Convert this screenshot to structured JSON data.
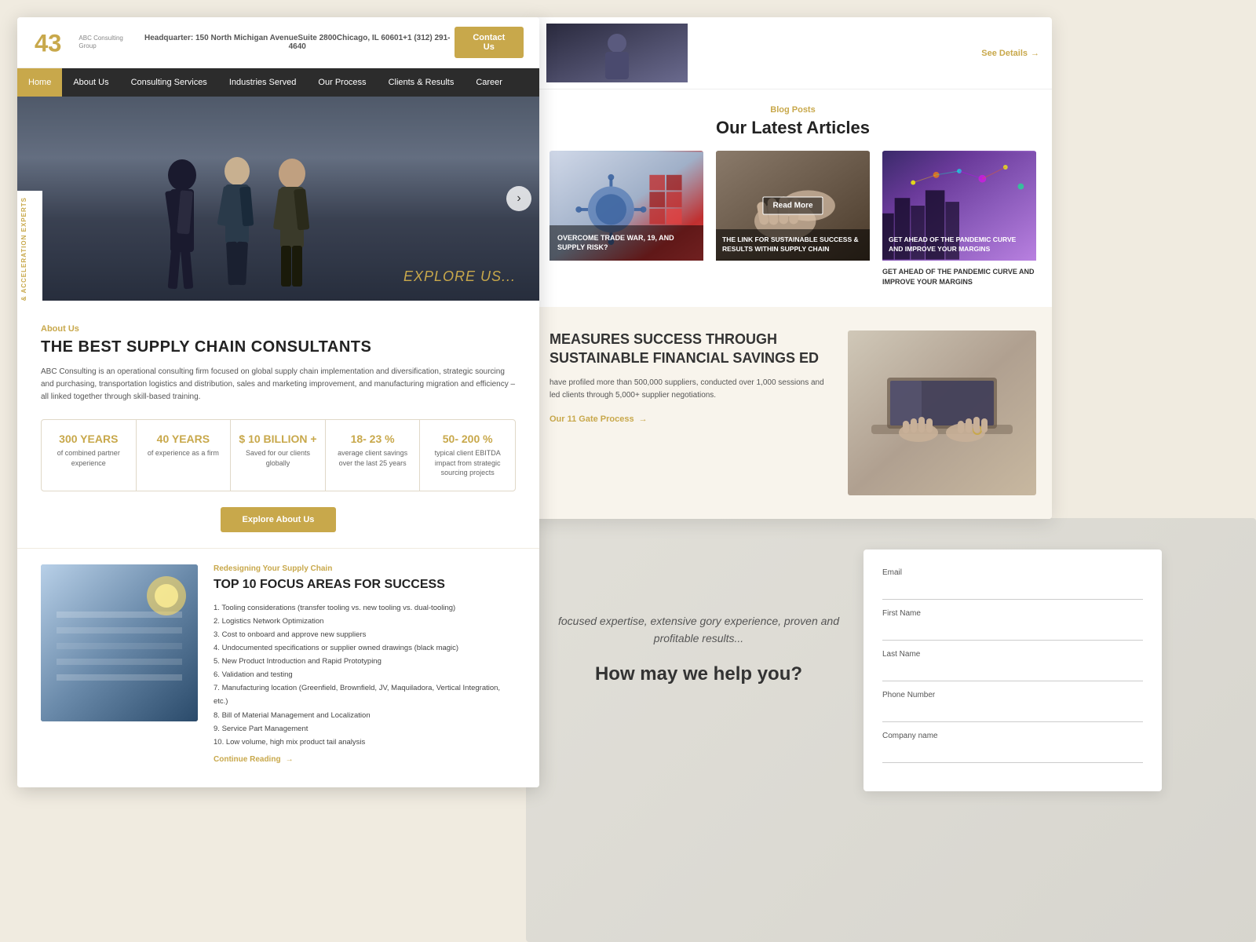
{
  "site": {
    "logo_text": "43",
    "logo_subtext": "ABC Consulting Group",
    "hq_label": "Headquarter:",
    "hq_address": "150 North Michigan AvenueSuite 2800Chicago, IL 60601+1 (312) 291-4640",
    "contact_btn": "Contact Us"
  },
  "nav": {
    "items": [
      {
        "label": "Home",
        "active": true
      },
      {
        "label": "About Us",
        "active": false
      },
      {
        "label": "Consulting Services",
        "active": false
      },
      {
        "label": "Industries Served",
        "active": false
      },
      {
        "label": "Our Process",
        "active": false
      },
      {
        "label": "Clients & Results",
        "active": false
      },
      {
        "label": "Career",
        "active": false
      }
    ]
  },
  "hero": {
    "explore_text": "EXPLORE US...",
    "vertical_text": "SUPPLY CHAIN DIVERSIFICATION & ACCELERATION EXPERTS"
  },
  "about": {
    "subtitle": "About Us",
    "title": "THE BEST SUPPLY CHAIN CONSULTANTS",
    "body": "ABC Consulting is an operational consulting firm focused on global supply chain implementation and diversification, strategic sourcing and purchasing, transportation logistics and distribution, sales and marketing improvement, and manufacturing migration and efficiency – all linked together through skill-based training.",
    "stats": [
      {
        "number": "300 YEARS",
        "label": "of combined partner experience"
      },
      {
        "number": "40 YEARS",
        "label": "of experience as a firm"
      },
      {
        "number": "$ 10 BILLION +",
        "label": "Saved for our clients globally"
      },
      {
        "number": "18- 23 %",
        "label": "average client savings over the last 25 years"
      },
      {
        "number": "50- 200 %",
        "label": "typical client EBITDA impact from strategic sourcing projects"
      }
    ],
    "explore_btn": "Explore About Us"
  },
  "focus": {
    "subtitle": "Redesigning Your Supply Chain",
    "title": "TOP 10 FOCUS AREAS FOR SUCCESS",
    "items": [
      "Tooling considerations (transfer tooling vs. new tooling vs. dual-tooling)",
      "Logistics Network Optimization",
      "Cost to onboard and approve new suppliers",
      "Undocumented specifications or supplier owned drawings (black magic)",
      "New Product Introduction and Rapid Prototyping",
      "Validation and testing",
      "Manufacturing location (Greenfield, Brownfield, JV, Maquiladora, Vertical Integration, etc.)",
      "Bill of Material Management and Localization",
      "Service Part Management",
      "Low volume, high mix product tail analysis"
    ],
    "continue_link": "Continue Reading"
  },
  "blog": {
    "section_label": "Blog Posts",
    "section_title": "Our Latest Articles",
    "see_details": "See Details",
    "articles": [
      {
        "id": 1,
        "caption": "OVERCOME TRADE WAR, 19, AND SUPPLY RISK?",
        "overlay_text": "OVERCOME TRADE WAR, 19, AND SUPPLY RISK?",
        "has_read_more": false,
        "img_type": "virus"
      },
      {
        "id": 2,
        "caption": "THE LINK FOR SUSTAINABLE SUCCESS & RESULTS WITHIN SUPPLY CHAIN",
        "overlay_text": "THE LINK FOR SUSTAINABLE SUCCESS & RESULTS WITHIN SUPPLY CHAIN",
        "has_read_more": true,
        "img_type": "hands"
      },
      {
        "id": 3,
        "caption": "GET AHEAD OF THE PANDEMIC CURVE AND IMPROVE YOUR MARGINS",
        "overlay_text": "GET AHEAD OF THE PANDEMIC CURVE AND IMPROVE YOUR MARGINS",
        "has_read_more": false,
        "img_type": "city"
      }
    ],
    "read_more_btn": "Read More"
  },
  "success": {
    "headline": "MEASURES SUCCESS THROUGH SUSTAINABLE FINANCIAL SAVINGS ED",
    "body": "have profiled more than 500,000 suppliers, conducted over 1,000 sessions and led clients through 5,000+ supplier negotiations.",
    "process_link": "Our 11 Gate Process"
  },
  "contact": {
    "tagline": "focused expertise, extensive gory experience, proven and profitable results...",
    "question": "How may we help you?",
    "fields": [
      {
        "label": "Email",
        "placeholder": ""
      },
      {
        "label": "First Name",
        "placeholder": ""
      },
      {
        "label": "Last Name",
        "placeholder": ""
      },
      {
        "label": "Phone Number",
        "placeholder": ""
      },
      {
        "label": "Company name",
        "placeholder": ""
      }
    ]
  }
}
